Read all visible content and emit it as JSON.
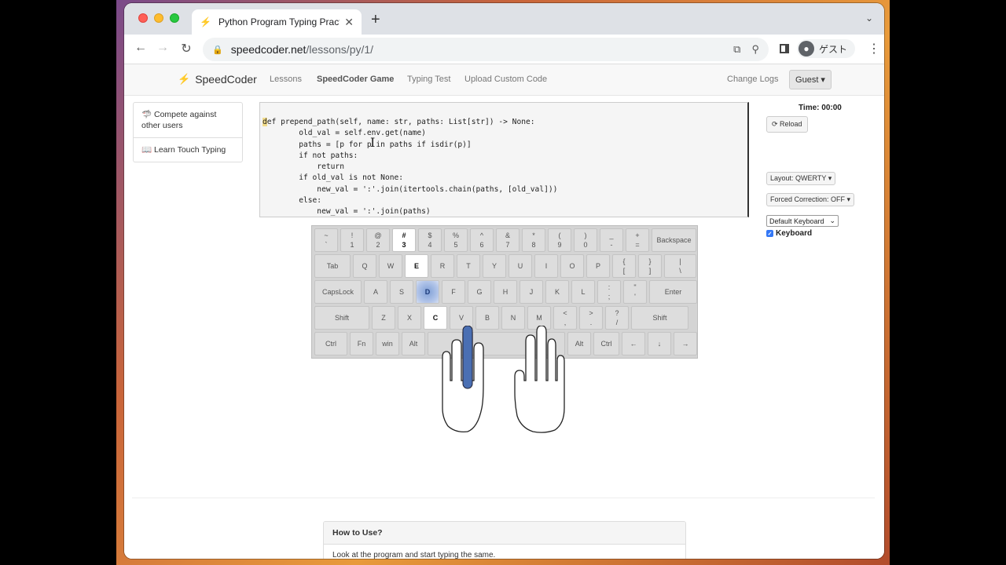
{
  "browser": {
    "tab_title": "Python Program Typing Practic",
    "url_host": "speedcoder.net",
    "url_path": "/lessons/py/1/",
    "profile_name": "ゲスト",
    "tab_favicon": "bolt-icon"
  },
  "site": {
    "brand": "SpeedCoder",
    "nav": {
      "lessons": "Lessons",
      "game": "SpeedCoder Game",
      "typing_test": "Typing Test",
      "upload": "Upload Custom Code",
      "change_logs": "Change Logs",
      "guest": "Guest ▾"
    }
  },
  "sidebar": {
    "compete": "🦈 Compete against other users",
    "learn": "📖 Learn Touch Typing"
  },
  "code": {
    "cursor_char": "d",
    "lines": [
      "ef prepend_path(self, name: str, paths: List[str]) -> None:",
      "        old_val = self.env.get(name)",
      "        paths = [p for p in paths if isdir(p)]",
      "        if not paths:",
      "            return",
      "        if old_val is not None:",
      "            new_val = ':'.join(itertools.chain(paths, [old_val]))",
      "        else:",
      "            new_val = ':'.join(paths)"
    ]
  },
  "controls": {
    "time_label": "Time:",
    "time_value": "00:00",
    "reload": "⟳ Reload",
    "layout": "Layout: QWERTY ▾",
    "forced": "Forced Correction: OFF ▾",
    "keyboard_select": "Default Keyboard",
    "keyboard_checkbox": "Keyboard"
  },
  "keyboard": {
    "row1": [
      [
        "~",
        "`"
      ],
      [
        "!",
        "1"
      ],
      [
        "@",
        "2"
      ],
      [
        "#",
        "3"
      ],
      [
        "$",
        "4"
      ],
      [
        "%",
        "5"
      ],
      [
        "^",
        "6"
      ],
      [
        "&",
        "7"
      ],
      [
        "*",
        "8"
      ],
      [
        "(",
        "9"
      ],
      [
        ")",
        "0"
      ],
      [
        "_",
        "-"
      ],
      [
        "+",
        "="
      ],
      [
        "Backspace",
        ""
      ]
    ],
    "row2": [
      "Tab",
      "Q",
      "W",
      "E",
      "R",
      "T",
      "Y",
      "U",
      "I",
      "O",
      "P",
      [
        "{",
        "["
      ],
      [
        "}",
        "]"
      ],
      [
        "|",
        "\\"
      ]
    ],
    "row3": [
      "CapsLock",
      "A",
      "S",
      "D",
      "F",
      "G",
      "H",
      "J",
      "K",
      "L",
      [
        ":",
        ";"
      ],
      [
        "\"",
        "'"
      ],
      "Enter"
    ],
    "row4": [
      "Shift",
      "Z",
      "X",
      "C",
      "V",
      "B",
      "N",
      "M",
      [
        "<",
        ","
      ],
      [
        ">",
        "."
      ],
      [
        "?",
        "/"
      ],
      "Shift"
    ],
    "row5": [
      "Ctrl",
      "Fn",
      "win",
      "Alt",
      "",
      "Alt",
      "Ctrl",
      "←",
      "↓",
      "→"
    ],
    "white_keys": [
      "#3",
      "E",
      "C"
    ],
    "active_key": "D",
    "active_finger": "left-middle"
  },
  "howto": {
    "title": "How to Use?",
    "body": "Look at the program and start typing the same."
  }
}
